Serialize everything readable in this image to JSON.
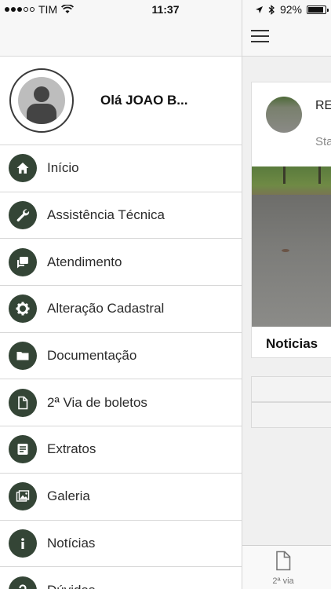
{
  "status_bar": {
    "carrier": "TIM",
    "time": "11:37",
    "battery": "92%",
    "battery_level": 0.92
  },
  "drawer": {
    "greeting": "Olá JOAO B...",
    "items": [
      {
        "label": "Início",
        "icon": "home-icon"
      },
      {
        "label": "Assistência Técnica",
        "icon": "wrench-icon"
      },
      {
        "label": "Atendimento",
        "icon": "chat-icon"
      },
      {
        "label": "Alteração Cadastral",
        "icon": "gear-icon"
      },
      {
        "label": "Documentação",
        "icon": "folder-icon"
      },
      {
        "label": "2ª Via de boletos",
        "icon": "document-icon"
      },
      {
        "label": "Extratos",
        "icon": "statement-icon"
      },
      {
        "label": "Galeria",
        "icon": "gallery-icon"
      },
      {
        "label": "Notícias",
        "icon": "info-icon"
      },
      {
        "label": "Dúvidas",
        "icon": "question-icon"
      }
    ]
  },
  "main": {
    "card": {
      "title": "RE ET/",
      "subtitle": "Sta",
      "tag": "Noticias"
    },
    "tabbar": {
      "tab_label": "2ª via"
    }
  },
  "colors": {
    "icon_bg": "#344536",
    "divider": "#d8d8d8"
  }
}
